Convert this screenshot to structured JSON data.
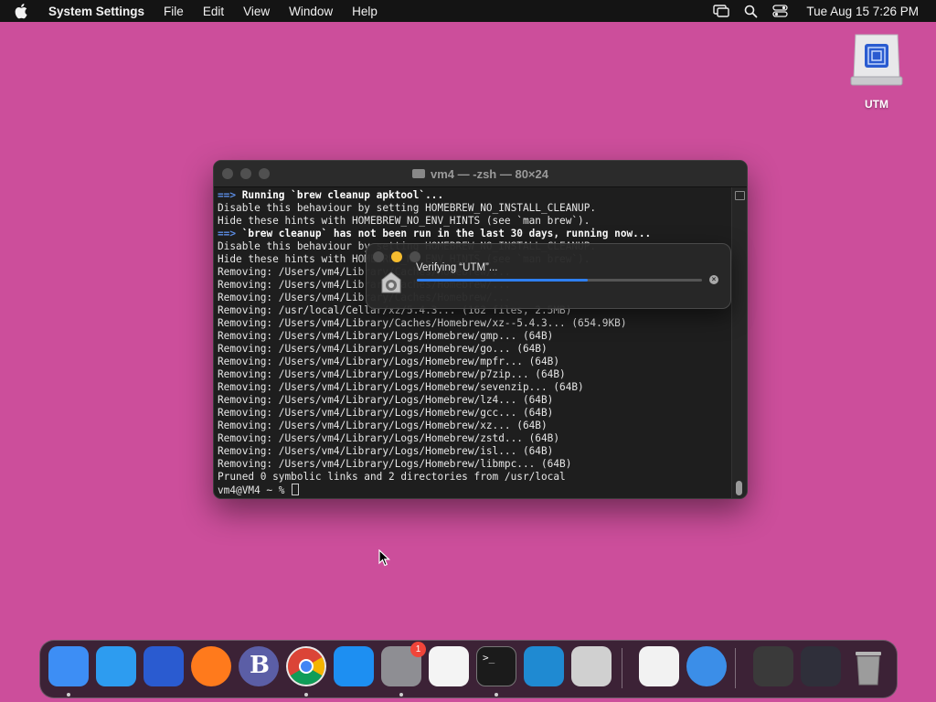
{
  "menubar": {
    "app_name": "System Settings",
    "items": [
      "File",
      "Edit",
      "View",
      "Window",
      "Help"
    ],
    "clock": "Tue Aug 15  7:26 PM"
  },
  "desktop": {
    "icons": [
      {
        "label": "UTM"
      }
    ]
  },
  "terminal": {
    "title": "vm4 — -zsh — 80×24",
    "lines": [
      {
        "arrow": "==>",
        "text": " Running `brew cleanup apktool`...",
        "bold": true
      },
      {
        "text": "Disable this behaviour by setting HOMEBREW_NO_INSTALL_CLEANUP."
      },
      {
        "text": "Hide these hints with HOMEBREW_NO_ENV_HINTS (see `man brew`)."
      },
      {
        "arrow": "==>",
        "text": " `brew cleanup` has not been run in the last 30 days, running now...",
        "bold": true
      },
      {
        "text": "Disable this behaviour by setting HOMEBREW_NO_INSTALL_CLEANUP."
      },
      {
        "text": "Hide these hints with HOMEBREW_NO_ENV_HINTS (see `man brew`)."
      },
      {
        "text": "Removing: /Users/vm4/Library/Caches/Homebrew/..."
      },
      {
        "text": "Removing: /Users/vm4/Library/Caches/Homebrew/..."
      },
      {
        "text": "Removing: /Users/vm4/Library/Caches/Homebrew/..."
      },
      {
        "text": "Removing: /usr/local/Cellar/xz/5.4.3... (162 files, 2.5MB)"
      },
      {
        "text": "Removing: /Users/vm4/Library/Caches/Homebrew/xz--5.4.3... (654.9KB)"
      },
      {
        "text": "Removing: /Users/vm4/Library/Logs/Homebrew/gmp... (64B)"
      },
      {
        "text": "Removing: /Users/vm4/Library/Logs/Homebrew/go... (64B)"
      },
      {
        "text": "Removing: /Users/vm4/Library/Logs/Homebrew/mpfr... (64B)"
      },
      {
        "text": "Removing: /Users/vm4/Library/Logs/Homebrew/p7zip... (64B)"
      },
      {
        "text": "Removing: /Users/vm4/Library/Logs/Homebrew/sevenzip... (64B)"
      },
      {
        "text": "Removing: /Users/vm4/Library/Logs/Homebrew/lz4... (64B)"
      },
      {
        "text": "Removing: /Users/vm4/Library/Logs/Homebrew/gcc... (64B)"
      },
      {
        "text": "Removing: /Users/vm4/Library/Logs/Homebrew/xz... (64B)"
      },
      {
        "text": "Removing: /Users/vm4/Library/Logs/Homebrew/zstd... (64B)"
      },
      {
        "text": "Removing: /Users/vm4/Library/Logs/Homebrew/isl... (64B)"
      },
      {
        "text": "Removing: /Users/vm4/Library/Logs/Homebrew/libmpc... (64B)"
      },
      {
        "text": "Pruned 0 symbolic links and 2 directories from /usr/local"
      },
      {
        "text": "vm4@VM4 ~ % ",
        "prompt": true
      }
    ]
  },
  "verify_dialog": {
    "text": "Verifying “UTM”...",
    "progress": 0.6
  },
  "dock": {
    "items": [
      {
        "name": "finder",
        "color": "#3d8ef5",
        "running": true
      },
      {
        "name": "safari",
        "color": "#2d9cf0",
        "running": false
      },
      {
        "name": "utm",
        "color": "#2a5bd0",
        "running": false
      },
      {
        "name": "firefox",
        "color": "#ff7a1c",
        "running": false
      },
      {
        "name": "bbedit",
        "color": "#5b5ea6",
        "running": false
      },
      {
        "name": "chrome",
        "color": "#e8e8e8",
        "running": true
      },
      {
        "name": "app-store",
        "color": "#1d8ff2",
        "running": false
      },
      {
        "name": "system-settings",
        "color": "#8e8e93",
        "running": true,
        "badge": "1"
      },
      {
        "name": "textedit",
        "color": "#f4f4f4",
        "running": false
      },
      {
        "name": "terminal",
        "color": "#1b1b1b",
        "running": true
      },
      {
        "name": "vscode",
        "color": "#1f8ad2",
        "running": false
      },
      {
        "name": "launchpad",
        "color": "#d0d0d0",
        "running": false
      },
      {
        "name": "visual-studio",
        "color": "#f2f2f2",
        "running": false
      },
      {
        "name": "weather",
        "color": "#3b8ee8",
        "running": false
      },
      {
        "name": "downloads-stack",
        "color": "#3a3a3a",
        "running": false
      },
      {
        "name": "recents-stack",
        "color": "#2f2f3a",
        "running": false
      },
      {
        "name": "trash",
        "color": "#9a9a9a",
        "running": false
      }
    ]
  }
}
